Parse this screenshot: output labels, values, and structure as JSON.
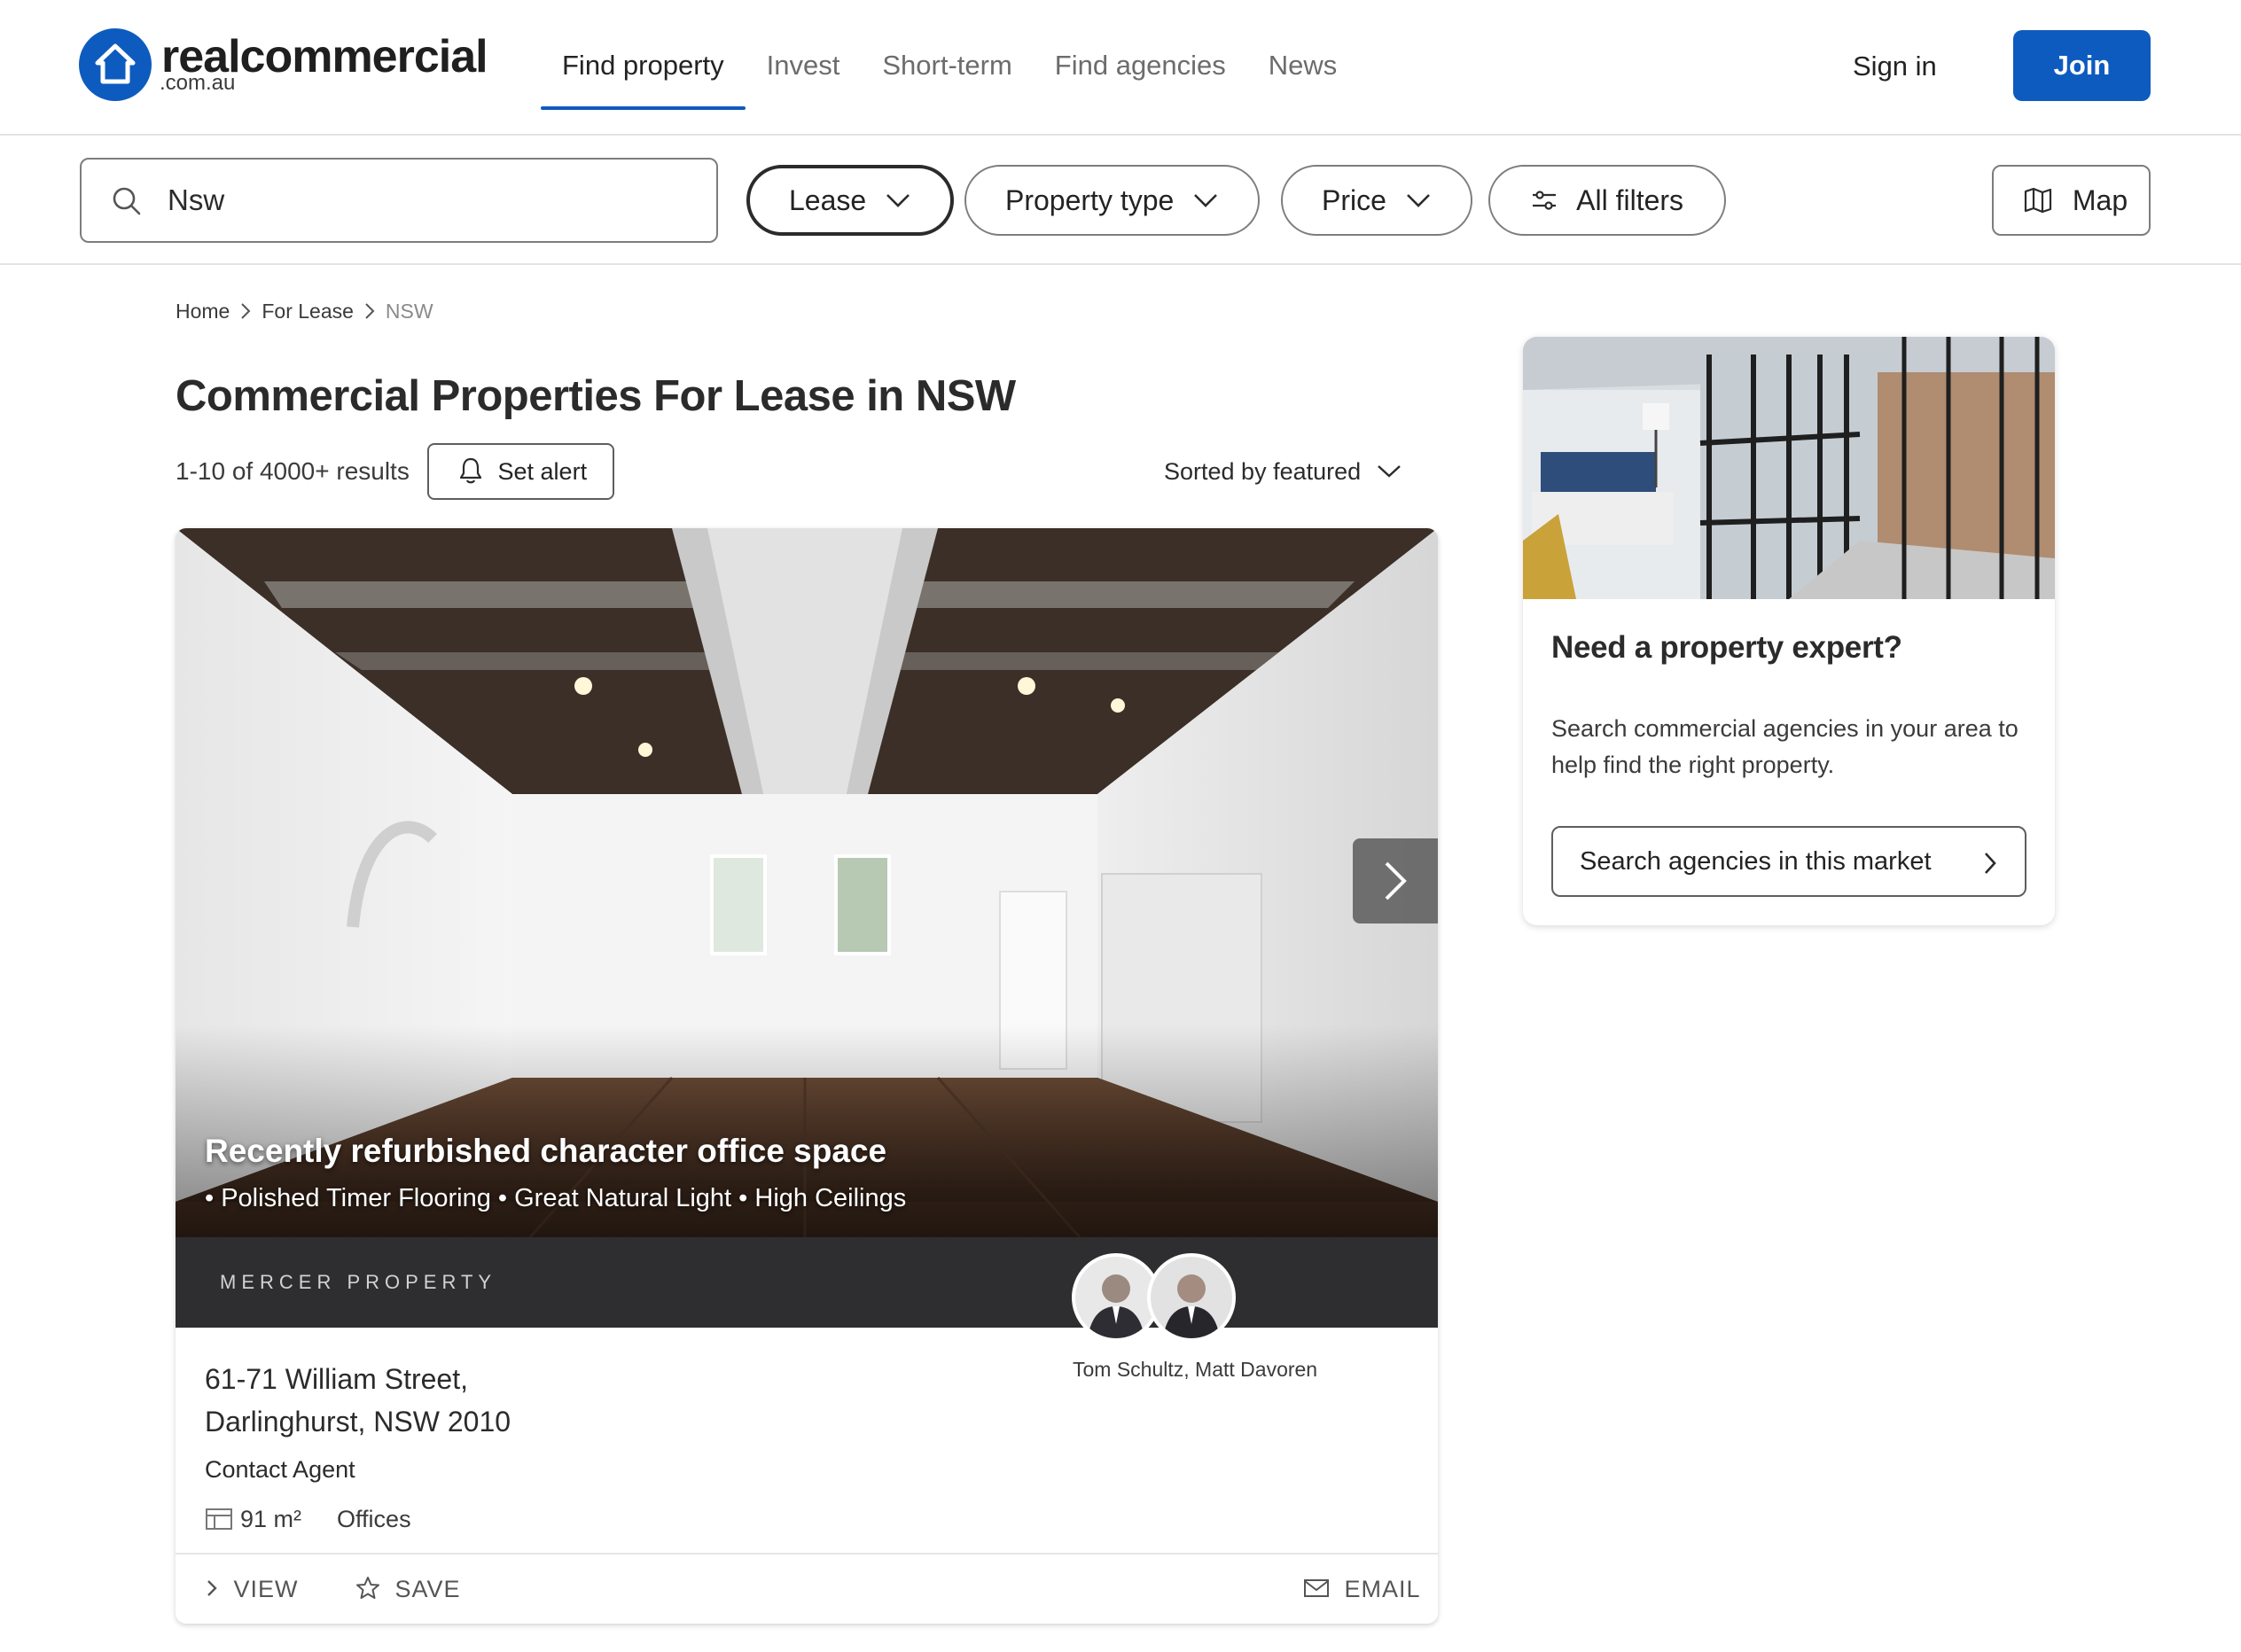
{
  "header": {
    "logo_text": "realcommercial",
    "logo_sub": ".com.au",
    "nav": [
      {
        "label": "Find property",
        "active": true
      },
      {
        "label": "Invest",
        "active": false
      },
      {
        "label": "Short-term",
        "active": false
      },
      {
        "label": "Find agencies",
        "active": false
      },
      {
        "label": "News",
        "active": false
      }
    ],
    "sign_in": "Sign in",
    "join": "Join"
  },
  "filters": {
    "search_value": "Nsw",
    "lease": "Lease",
    "property_type": "Property type",
    "price": "Price",
    "all_filters": "All filters",
    "map": "Map"
  },
  "breadcrumb": {
    "home": "Home",
    "for_lease": "For Lease",
    "current": "NSW"
  },
  "results": {
    "title": "Commercial Properties For Lease in NSW",
    "count": "1-10 of 4000+ results",
    "set_alert": "Set alert",
    "sort": "Sorted by featured"
  },
  "listing": {
    "headline": "Recently refurbished character office space",
    "subheadline": "• Polished Timer Flooring • Great Natural Light • High Ceilings",
    "agency": "MERCER PROPERTY",
    "agents": "Tom Schultz, Matt Davoren",
    "address_line1": "61-71 William Street,",
    "address_line2": "Darlinghurst, NSW 2010",
    "price": "Contact Agent",
    "size": "91 m²",
    "property_type": "Offices",
    "actions": {
      "view": "VIEW",
      "save": "SAVE",
      "email": "EMAIL"
    }
  },
  "promo": {
    "title": "Need a property expert?",
    "text": "Search commercial agencies in your area to help find the right property.",
    "button": "Search agencies in this market"
  },
  "colors": {
    "brand_blue": "#0e5bbf",
    "text_dark": "#2b2b2b",
    "agency_bar": "#2e2e30"
  }
}
